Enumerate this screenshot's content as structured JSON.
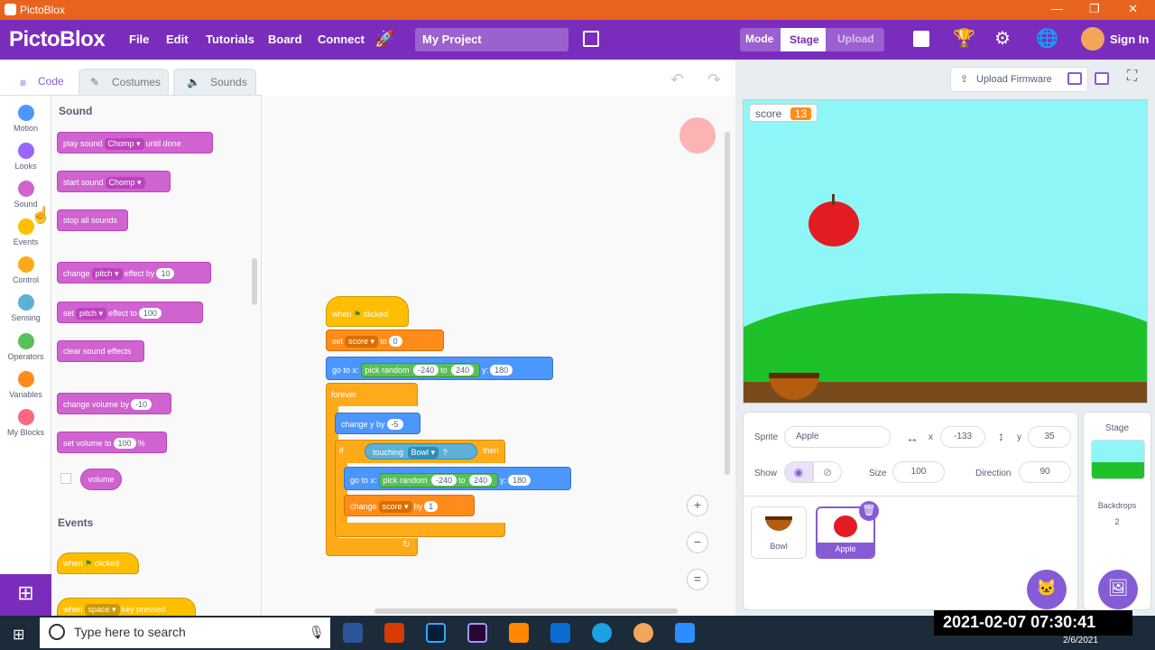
{
  "window": {
    "title": "PictoBlox",
    "controls": [
      "—",
      "❐",
      "✕"
    ]
  },
  "menubar": {
    "logo": "PictoBlox",
    "items": [
      "File",
      "Edit",
      "Tutorials",
      "Board",
      "Connect"
    ],
    "project_name": "My Project",
    "mode_label": "Mode",
    "stage_label": "Stage",
    "upload_label": "Upload",
    "signin": "Sign In"
  },
  "tabs": {
    "code": "Code",
    "costumes": "Costumes",
    "sounds": "Sounds"
  },
  "categories": [
    {
      "label": "Motion",
      "color": "#4c97ff"
    },
    {
      "label": "Looks",
      "color": "#9966ff"
    },
    {
      "label": "Sound",
      "color": "#cf63cf"
    },
    {
      "label": "Events",
      "color": "#ffbf00"
    },
    {
      "label": "Control",
      "color": "#ffab19"
    },
    {
      "label": "Sensing",
      "color": "#5cb1d6"
    },
    {
      "label": "Operators",
      "color": "#59c059"
    },
    {
      "label": "Variables",
      "color": "#ff8c1a"
    },
    {
      "label": "My Blocks",
      "color": "#ff6680"
    }
  ],
  "palette": {
    "sound_header": "Sound",
    "play_sound": {
      "a": "play sound",
      "dd": "Chomp",
      "b": "until done"
    },
    "start_sound": {
      "a": "start sound",
      "dd": "Chomp"
    },
    "stop_all": "stop all sounds",
    "change_effect": {
      "a": "change",
      "dd": "pitch",
      "b": "effect by",
      "v": "10"
    },
    "set_effect": {
      "a": "set",
      "dd": "pitch",
      "b": "effect to",
      "v": "100"
    },
    "clear_effects": "clear sound effects",
    "change_volume": {
      "a": "change volume by",
      "v": "-10"
    },
    "set_volume": {
      "a": "set volume to",
      "v": "100",
      "b": "%"
    },
    "volume": "volume",
    "events_header": "Events",
    "when_clicked": {
      "a": "when",
      "b": "clicked"
    },
    "when_key": {
      "a": "when",
      "dd": "space",
      "b": "key pressed"
    }
  },
  "script": {
    "hat": {
      "a": "when",
      "b": "clicked"
    },
    "set_score": {
      "a": "set",
      "dd": "score",
      "b": "to",
      "v": "0"
    },
    "goto1": {
      "a": "go to x:",
      "op": "pick random",
      "r1": "-240",
      "to": "to",
      "r2": "240",
      "y": "y:",
      "yv": "180"
    },
    "forever": "forever",
    "change_y": {
      "a": "change y by",
      "v": "-5"
    },
    "if": {
      "a": "if",
      "sense": "touching",
      "dd": "Bowl",
      "q": "?",
      "then": "then"
    },
    "goto2": {
      "a": "go to x:",
      "op": "pick random",
      "r1": "-240",
      "to": "to",
      "r2": "240",
      "y": "y:",
      "yv": "180"
    },
    "change_score": {
      "a": "change",
      "dd": "score",
      "b": "by",
      "v": "1"
    }
  },
  "toolbar": {
    "upload_firmware": "Upload Firmware"
  },
  "stage": {
    "var_name": "score",
    "var_value": "13"
  },
  "sprite_info": {
    "sprite_label": "Sprite",
    "sprite_name": "Apple",
    "x_label": "x",
    "x": "-133",
    "y_label": "y",
    "y": "35",
    "show_label": "Show",
    "size_label": "Size",
    "size": "100",
    "direction_label": "Direction",
    "direction": "90"
  },
  "sprites": [
    {
      "name": "Bowl"
    },
    {
      "name": "Apple"
    }
  ],
  "stage_panel": {
    "title": "Stage",
    "backdrops_label": "Backdrops",
    "backdrops_count": "2"
  },
  "taskbar": {
    "search_placeholder": "Type here to search",
    "time": "2021-02-07 07:30:41",
    "date": "2/6/2021"
  }
}
